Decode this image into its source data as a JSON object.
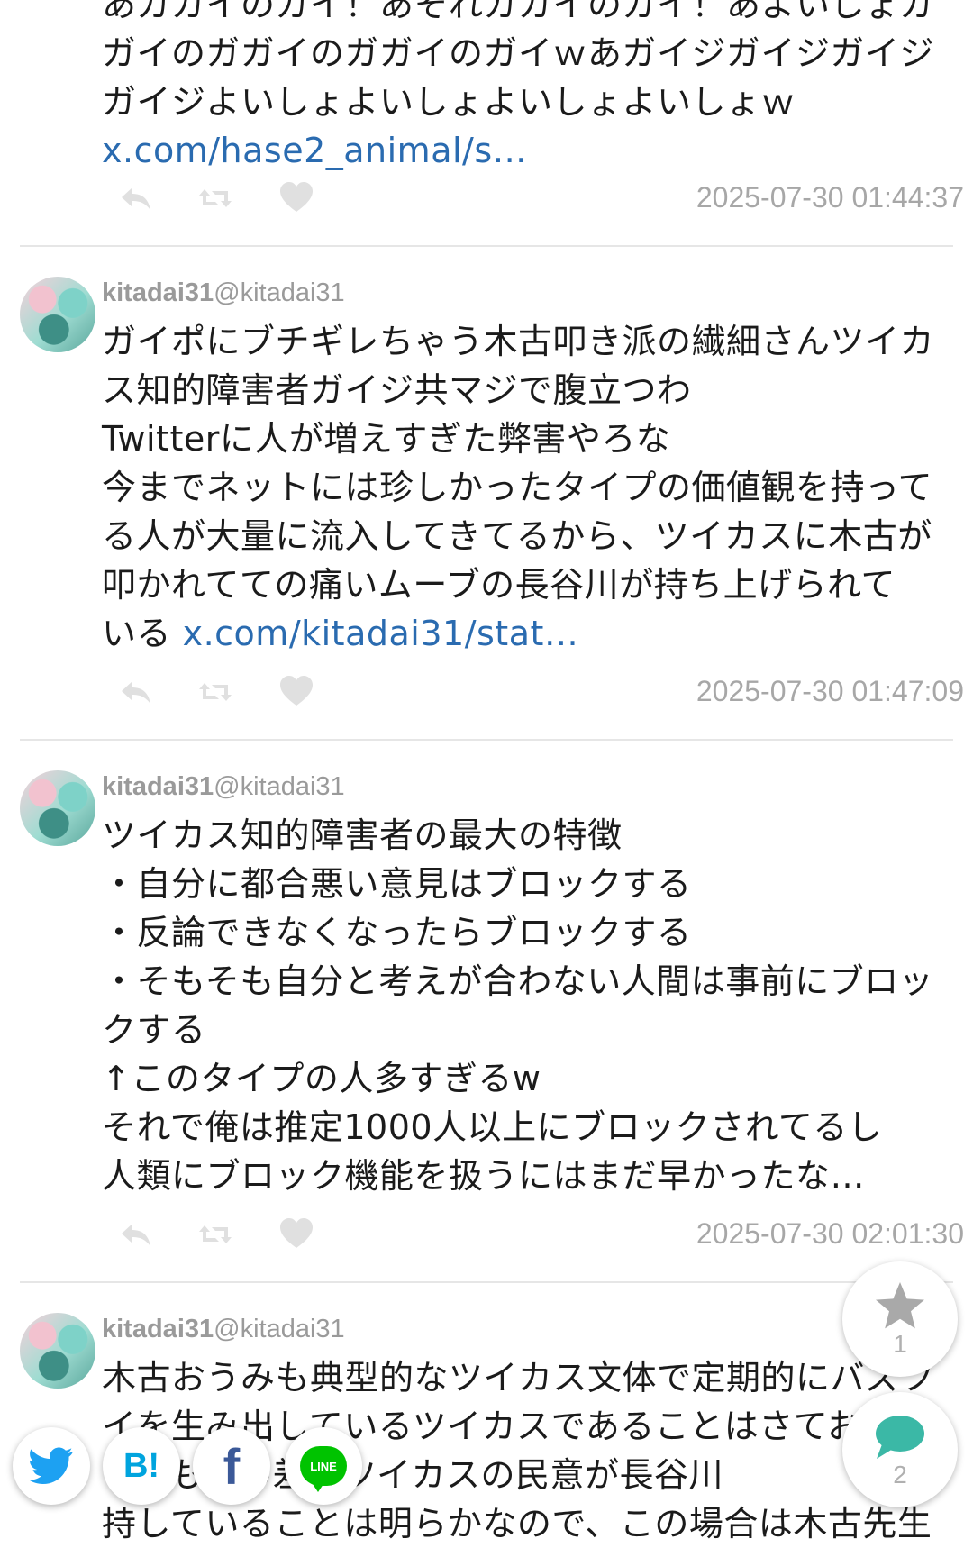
{
  "posts": [
    {
      "id": "p1",
      "lines": [
        "あガガイのガイ！あそれガガイのガイ！あよいしょガ",
        "ガイのガガイのガガイのガイｗあガイジガイジガイジ",
        "ガイジよいしょよいしょよいしょよいしょｗ"
      ],
      "link": "x.com/hase2_animal/s…",
      "time": "2025-07-30 01:44:37"
    },
    {
      "id": "p2",
      "user_name": "kitadai31",
      "user_handle": "@kitadai31",
      "lines": [
        "ガイポにブチギレちゃう木古叩き派の繊細さんツイカ",
        "ス知的障害者ガイジ共マジで腹立つわ",
        "Twitterに人が増えすぎた弊害やろな",
        "今までネットには珍しかったタイプの価値観を持って",
        "る人が大量に流入してきてるから、ツイカスに木古が",
        "叩かれてての痛いムーブの長谷川が持ち上げられて"
      ],
      "last_line_text": "いる ",
      "link": "x.com/kitadai31/stat…",
      "time": "2025-07-30 01:47:09"
    },
    {
      "id": "p3",
      "user_name": "kitadai31",
      "user_handle": "@kitadai31",
      "lines": [
        "ツイカス知的障害者の最大の特徴",
        "・自分に都合悪い意見はブロックする",
        "・反論できなくなったらブロックする",
        "・そもそも自分と考えが合わない人間は事前にブロッ",
        "クする",
        "↑このタイプの人多すぎるw",
        "それで俺は推定1000人以上にブロックされてるし",
        "人類にブロック機能を扱うにはまだ早かったな…"
      ],
      "time": "2025-07-30 02:01:30"
    },
    {
      "id": "p4",
      "user_name": "kitadai31",
      "user_handle": "@kitadai31",
      "lines": [
        "木古おうみも典型的なツイカス文体で定期的にバズツ",
        "イを生み出しているツイカスであることはさてお",
        "いても数の差でツイカスの民意が長谷川",
        "持していることは明らかなので、この場合は木古先生"
      ]
    }
  ],
  "fabs": {
    "favorite_count": "1",
    "comment_count": "2"
  },
  "share": {
    "hatena_label": "B!",
    "facebook_label": "f",
    "line_label": "LINE"
  },
  "colors": {
    "link": "#2a6bb0",
    "twitter": "#1da1f2",
    "hatena": "#00a4de",
    "facebook": "#3b5998",
    "line": "#00c300",
    "comment": "#3bb8a6"
  }
}
